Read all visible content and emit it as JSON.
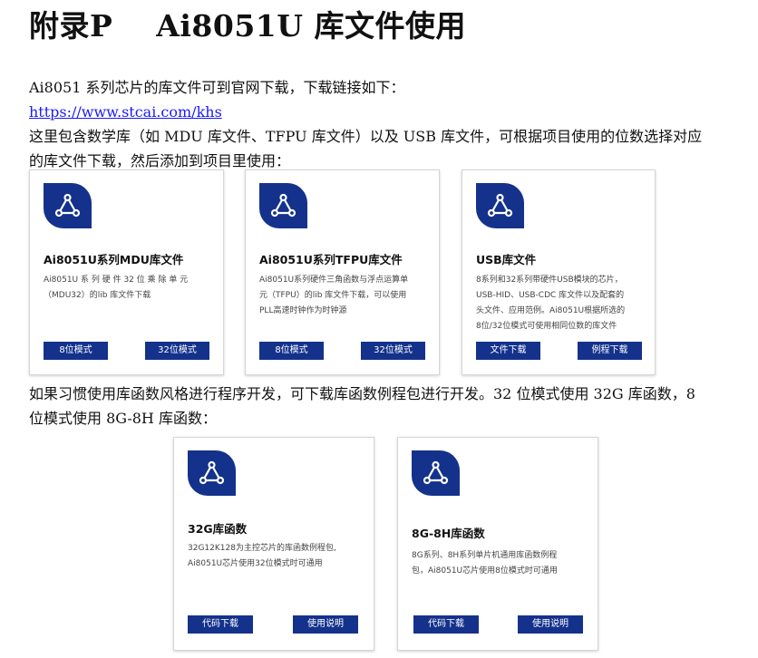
{
  "header": {
    "title": "附录P    Ai8051U 库文件使用"
  },
  "intro": {
    "line1": "Ai8051 系列芯片的库文件可到官网下载，下载链接如下：",
    "link": "https://www.stcai.com/khs",
    "line3": "这里包含数学库（如 MDU 库文件、TFPU 库文件）以及 USB 库文件，可根据项目使用的位数选择对应",
    "line4": "的库文件下载，然后添加到项目里使用："
  },
  "cards_row1": [
    {
      "title": "Ai8051U系列MDU库文件",
      "desc": [
        "Ai8051U 系 列 硬 件 32 位 乘 除 单 元",
        "（MDU32）的lib 库文件下载"
      ],
      "btn_left": "8位模式",
      "btn_right": "32位模式"
    },
    {
      "title": "Ai8051U系列TFPU库文件",
      "desc": [
        "Ai8051U系列硬件三角函数与浮点运算单",
        "元（TFPU）的lib 库文件下载，可以使用",
        "PLL高速时钟作为时钟源"
      ],
      "btn_left": "8位模式",
      "btn_right": "32位模式"
    },
    {
      "title": "USB库文件",
      "desc": [
        "8系列和32系列带硬件USB模块的芯片，",
        "USB-HID、USB-CDC 库文件以及配套的",
        "头文件、应用范例。Ai8051U根据所选的",
        "8位/32位模式可使用相同位数的库文件"
      ],
      "btn_left": "文件下载",
      "btn_right": "例程下载"
    }
  ],
  "middle": {
    "line1": "如果习惯使用库函数风格进行程序开发，可下载库函数例程包进行开发。32 位模式使用 32G 库函数，8",
    "line2": "位模式使用 8G-8H 库函数："
  },
  "cards_row2": [
    {
      "title": "32G库函数",
      "desc": [
        "32G12K128为主控芯片的库函数例程包,",
        "Ai8051U芯片使用32位模式时可通用"
      ],
      "btn_left": "代码下载",
      "btn_right": "使用说明"
    },
    {
      "title": "8G-8H库函数",
      "desc": [
        "8G系列、8H系列单片机通用库函数例程",
        "包，Ai8051U芯片使用8位模式时可通用"
      ],
      "btn_left": "代码下载",
      "btn_right": "使用说明"
    }
  ],
  "colors": {
    "card_accent": "#14328c",
    "link": "#1a1aff"
  }
}
